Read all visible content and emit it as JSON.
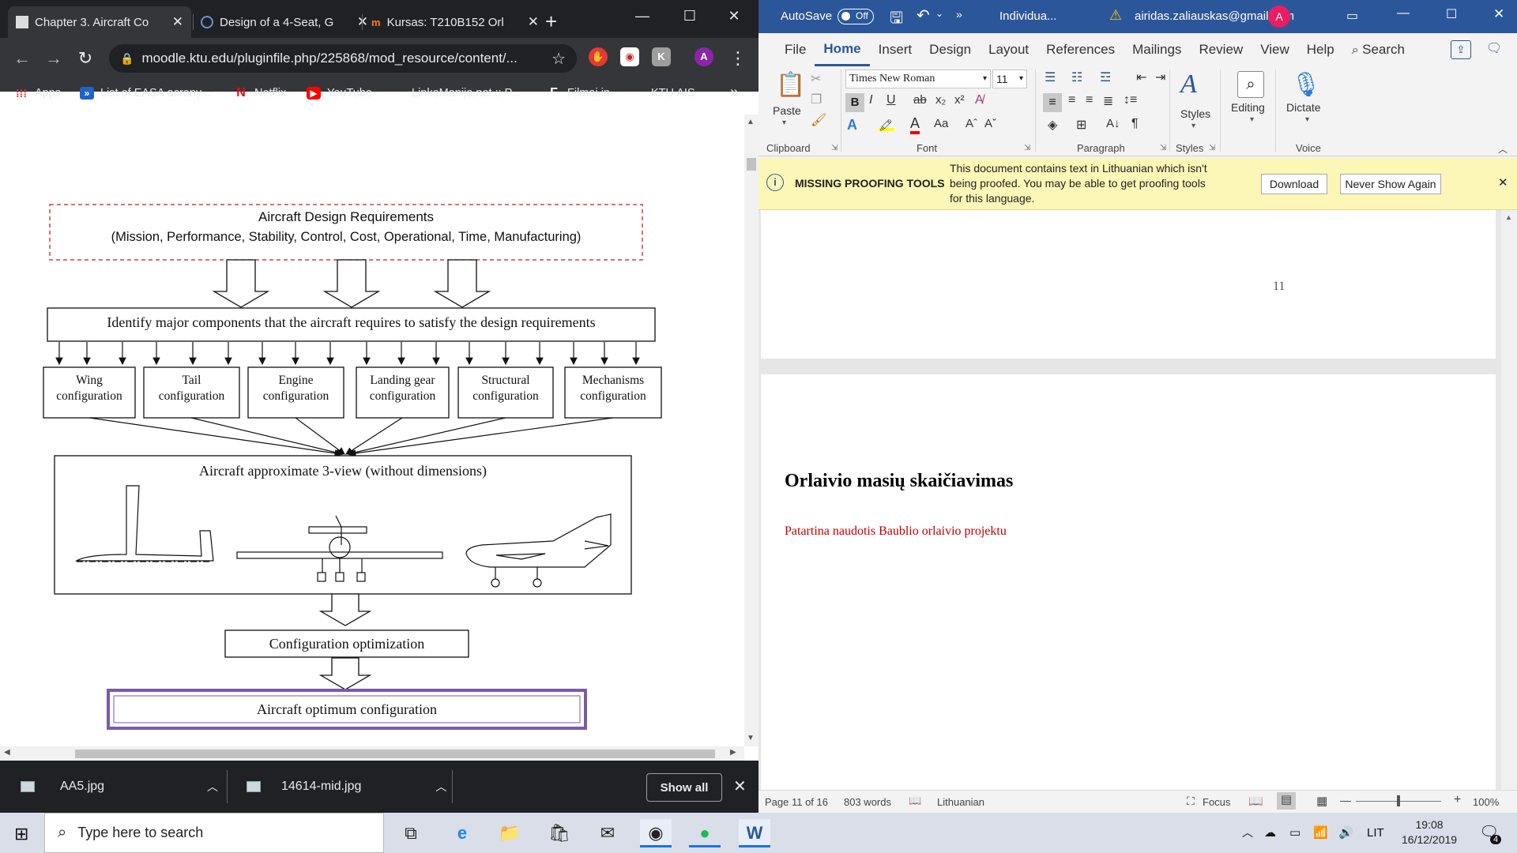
{
  "chrome": {
    "tabs": [
      {
        "title": "Chapter 3. Aircraft Co",
        "active": true
      },
      {
        "title": "Design of a 4-Seat, G",
        "active": false
      },
      {
        "title": "Kursas: T210B152 Orl",
        "active": false
      }
    ],
    "url": "moodle.ktu.edu/pluginfile.php/225868/mod_resource/content/...",
    "bookmarks": [
      "Apps",
      "List of EASA acrony...",
      "Netflix",
      "YouTube",
      "LinkoManija.net :: P...",
      "Filmai.in",
      "KTU AIS"
    ],
    "profile_initial": "A",
    "downloads": [
      "AA5.jpg",
      "14614-mid.jpg"
    ],
    "show_all": "Show all"
  },
  "diagram": {
    "requirements_title": "Aircraft Design Requirements",
    "requirements_sub": "(Mission, Performance, Stability, Control, Cost, Operational, Time, Manufacturing)",
    "identify": "Identify major components that the aircraft requires to satisfy the design requirements",
    "components": [
      [
        "Wing",
        "configuration"
      ],
      [
        "Tail",
        "configuration"
      ],
      [
        "Engine",
        "configuration"
      ],
      [
        "Landing gear",
        "configuration"
      ],
      [
        "Structural",
        "configuration"
      ],
      [
        "Mechanisms",
        "configuration"
      ]
    ],
    "three_view": "Aircraft approximate 3-view (without dimensions)",
    "optimization": "Configuration optimization",
    "optimum": "Aircraft optimum configuration"
  },
  "word": {
    "autosave": "AutoSave",
    "autosave_state": "Off",
    "doc_title": "Individua...",
    "account": "airidas.zaliauskas@gmail.com",
    "account_initial": "A",
    "ribbon_tabs": [
      "File",
      "Home",
      "Insert",
      "Design",
      "Layout",
      "References",
      "Mailings",
      "Review",
      "View",
      "Help",
      "Search"
    ],
    "font_name": "Times New Roman",
    "font_size": "11",
    "paste": "Paste",
    "styles": "Styles",
    "editing": "Editing",
    "dictate": "Dictate",
    "groups": [
      "Clipboard",
      "Font",
      "Paragraph",
      "Styles",
      "Voice"
    ],
    "message": {
      "title": "MISSING PROOFING TOOLS",
      "text_line1": "This document contains text in Lithuanian which isn't",
      "text_line2": "being proofed. You may be able to get proofing tools",
      "text_line3": "for this language.",
      "download": "Download",
      "never": "Never Show Again"
    },
    "page_number": "11",
    "heading": "Orlaivio masių skaičiavimas",
    "subtext": "Patartina naudotis Baublio orlaivio projektu",
    "status": {
      "page": "Page 11 of 16",
      "words": "803 words",
      "language": "Lithuanian",
      "focus": "Focus",
      "zoom": "100%"
    }
  },
  "taskbar": {
    "search_placeholder": "Type here to search",
    "lang": "LIT",
    "time": "19:08",
    "date": "16/12/2019",
    "notif_count": "4"
  }
}
